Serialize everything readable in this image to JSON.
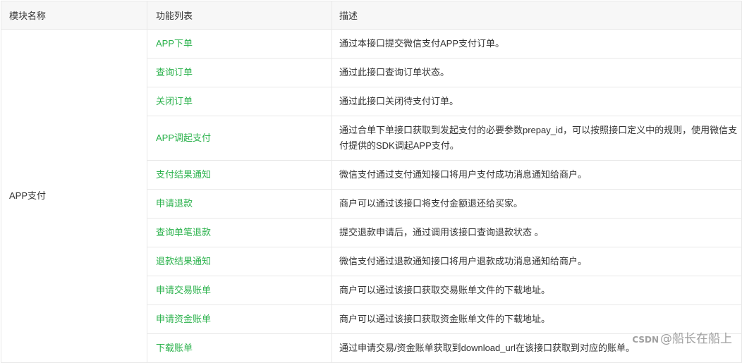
{
  "table": {
    "headers": [
      "模块名称",
      "功能列表",
      "描述"
    ],
    "module": "APP支付",
    "rows": [
      {
        "func": "APP下单",
        "desc": "通过本接口提交微信支付APP支付订单。"
      },
      {
        "func": "查询订单",
        "desc": "通过此接口查询订单状态。"
      },
      {
        "func": "关闭订单",
        "desc": "通过此接口关闭待支付订单。"
      },
      {
        "func": "APP调起支付",
        "desc": "通过合单下单接口获取到发起支付的必要参数prepay_id，可以按照接口定义中的规则，使用微信支付提供的SDK调起APP支付。"
      },
      {
        "func": "支付结果通知",
        "desc": "微信支付通过支付通知接口将用户支付成功消息通知给商户。"
      },
      {
        "func": "申请退款",
        "desc": "商户可以通过该接口将支付金额退还给买家。"
      },
      {
        "func": "查询单笔退款",
        "desc": "提交退款申请后，通过调用该接口查询退款状态 。"
      },
      {
        "func": "退款结果通知",
        "desc": "微信支付通过退款通知接口将用户退款成功消息通知给商户。"
      },
      {
        "func": "申请交易账单",
        "desc": "商户可以通过该接口获取交易账单文件的下载地址。"
      },
      {
        "func": "申请资金账单",
        "desc": "商户可以通过该接口获取资金账单文件的下载地址。"
      },
      {
        "func": "下载账单",
        "desc": "通过申请交易/资金账单获取到download_url在该接口获取到对应的账单。"
      }
    ]
  },
  "watermark": {
    "brand": "CSDN",
    "text": "@船长在船上"
  },
  "colors": {
    "link_green": "#2bb24c",
    "header_bg": "#f7f7f7",
    "border": "#e8e8e8"
  }
}
